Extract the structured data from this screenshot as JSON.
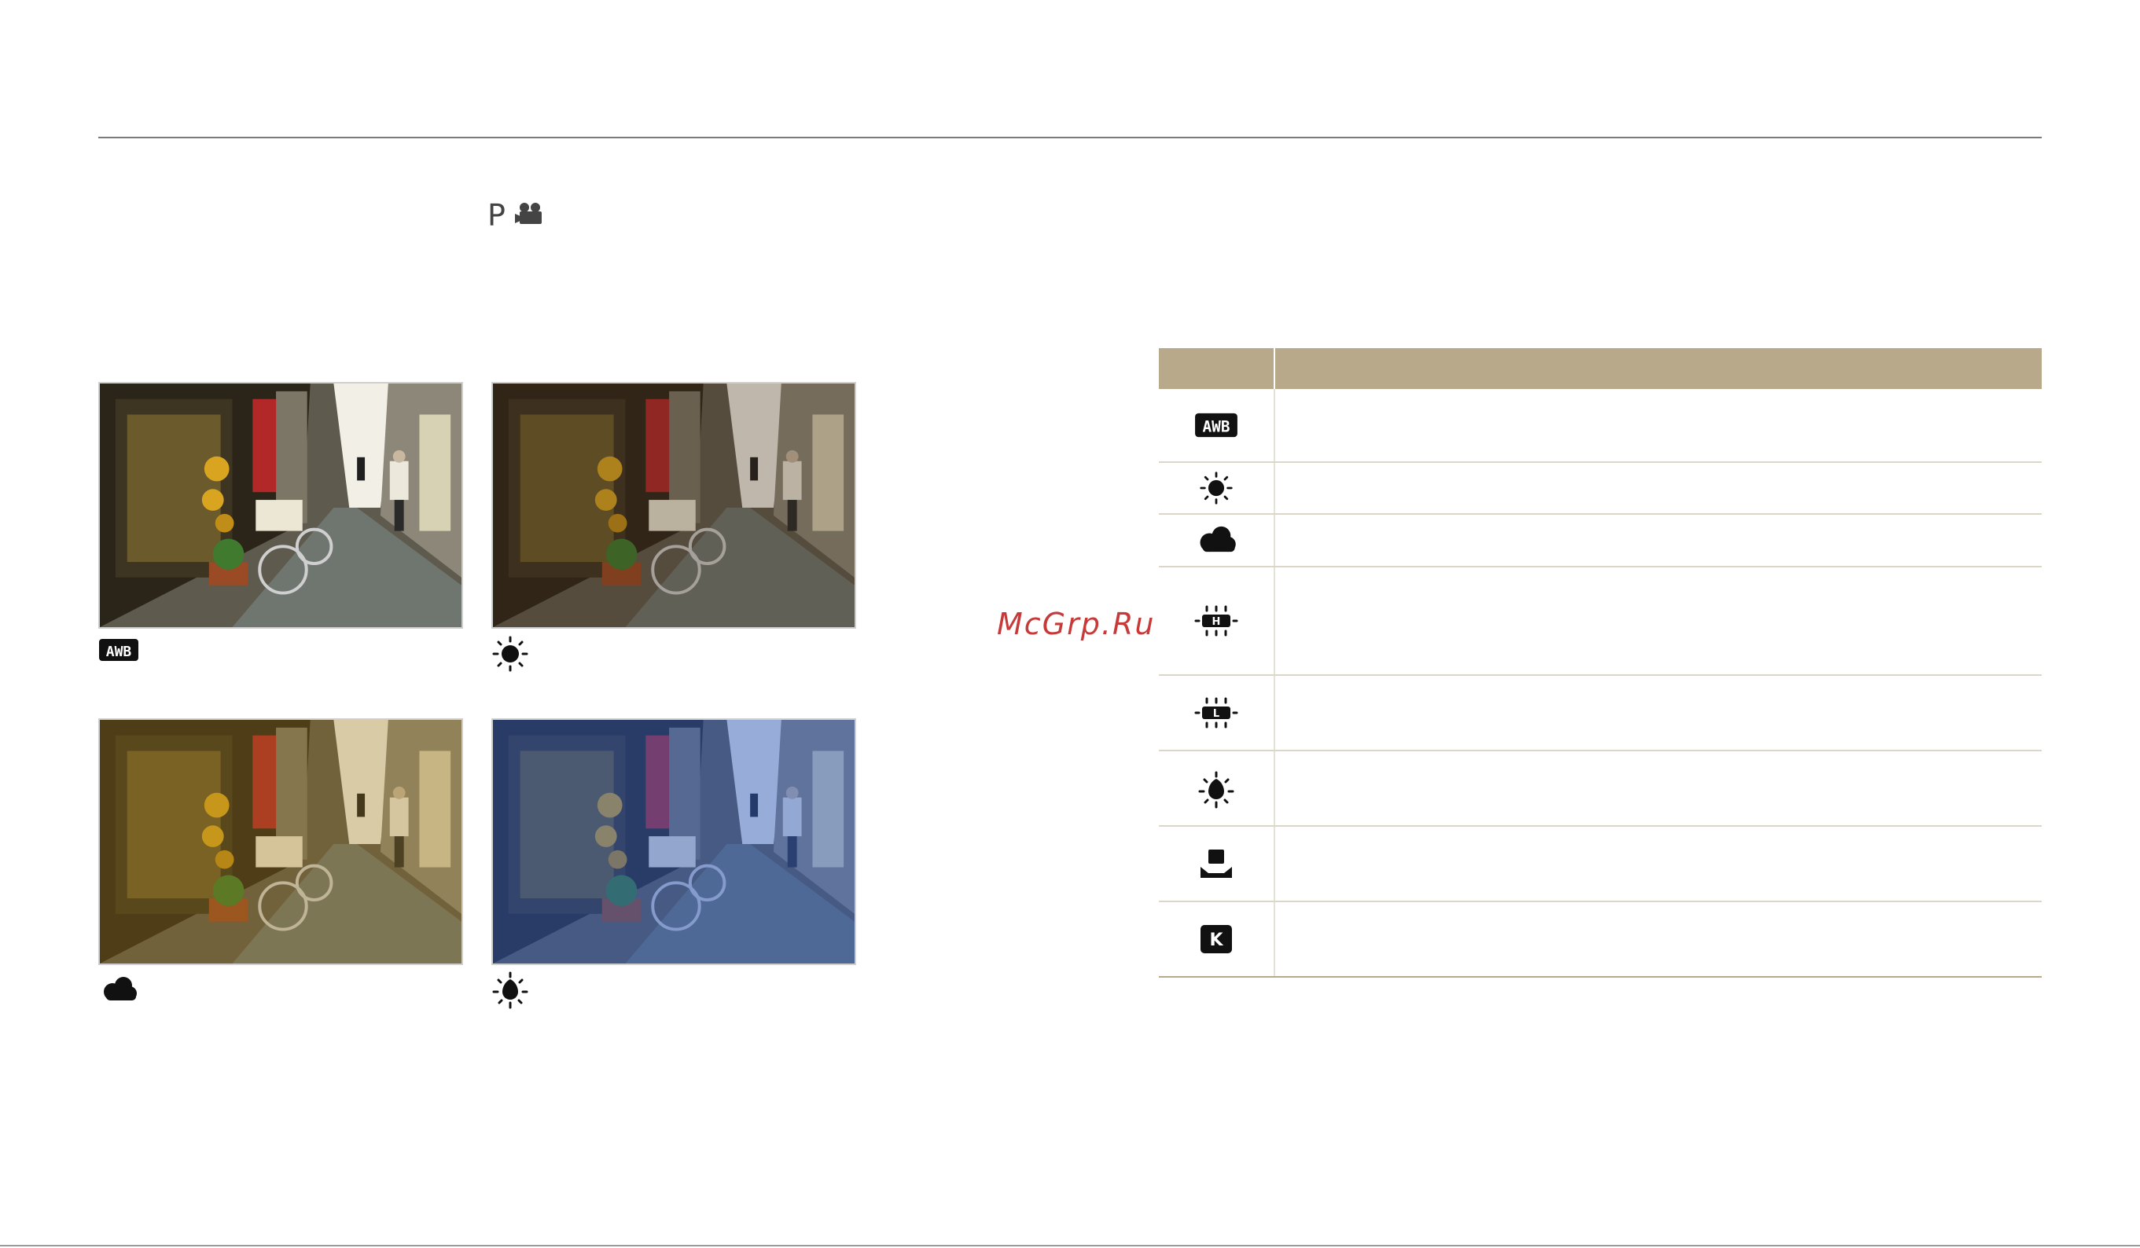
{
  "page": {
    "mode_label": "P",
    "mode_icons": [
      "program-mode",
      "movie-camera-icon"
    ],
    "watermark": "McGrp.Ru"
  },
  "photos": [
    {
      "caption_icon": "awb-icon",
      "tint": "neutral"
    },
    {
      "caption_icon": "daylight-sun-icon",
      "tint": "warm-dim"
    },
    {
      "caption_icon": "cloudy-icon",
      "tint": "yellow-warm"
    },
    {
      "caption_icon": "tungsten-bulb-icon",
      "tint": "blue"
    }
  ],
  "table": {
    "header": [
      "",
      ""
    ],
    "rows": [
      {
        "icon": "awb-icon",
        "text": ""
      },
      {
        "icon": "daylight-sun-icon",
        "text": ""
      },
      {
        "icon": "cloudy-icon",
        "text": ""
      },
      {
        "icon": "fluorescent-h-icon",
        "text": ""
      },
      {
        "icon": "fluorescent-l-icon",
        "text": ""
      },
      {
        "icon": "tungsten-bulb-icon",
        "text": ""
      },
      {
        "icon": "custom-set-icon",
        "text": ""
      },
      {
        "icon": "color-temperature-k-icon",
        "text": ""
      }
    ]
  },
  "colors": {
    "table_header": "#b8a98b",
    "rule": "#7a7a7a",
    "watermark": "#c63a3a"
  }
}
